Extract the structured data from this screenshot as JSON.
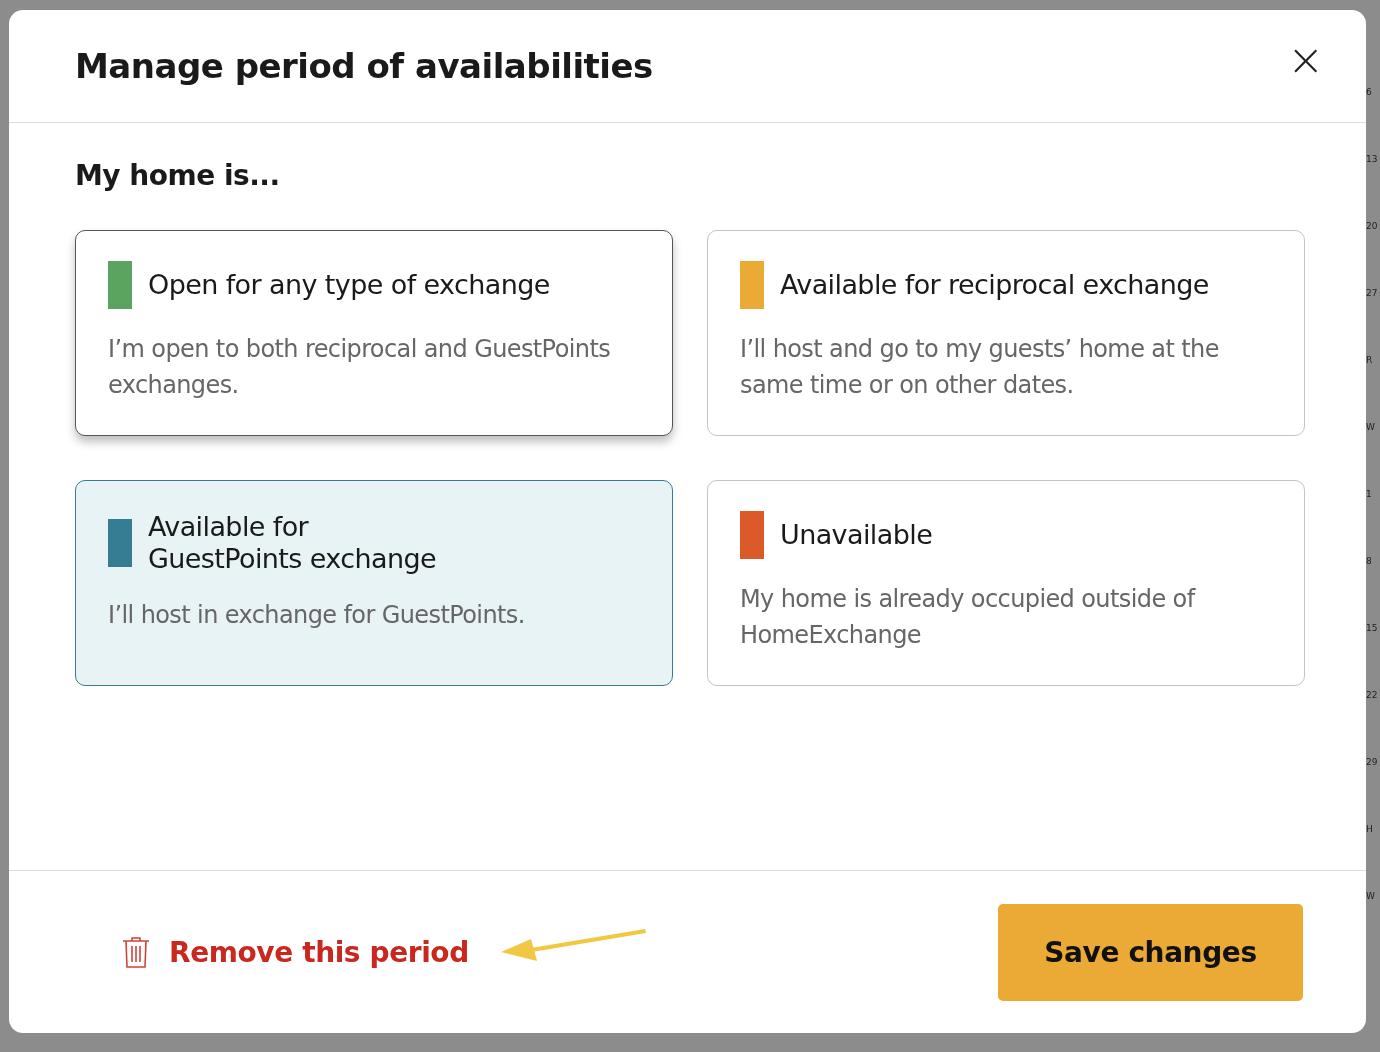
{
  "dialog": {
    "title": "Manage period of availabilities",
    "close": "×"
  },
  "section_title": "My home is...",
  "options": [
    {
      "title": "Open for any type of exchange",
      "description": "I’m open to both reciprocal and GuestPoints exchanges.",
      "color": "#5ba45f",
      "selected": false,
      "hovered": true
    },
    {
      "title": "Available for reciprocal exchange",
      "description": "I’ll host and go to my guests’ home at the same time or on other dates.",
      "color": "#eba935",
      "selected": false,
      "hovered": false
    },
    {
      "title": "Available for\nGuestPoints exchange",
      "description": "I’ll host in exchange for GuestPoints.",
      "color": "#367c93",
      "selected": true,
      "hovered": false
    },
    {
      "title": "Unavailable",
      "description": "My home is already occupied outside of HomeExchange",
      "color": "#dc5a2a",
      "selected": false,
      "hovered": false
    }
  ],
  "footer": {
    "remove_link": "Remove this period",
    "save_button": "Save changes"
  },
  "background_column": [
    "6",
    "13",
    "20",
    "27",
    "R",
    "W",
    "1",
    "8",
    "15",
    "22",
    "29",
    "H",
    "W"
  ]
}
